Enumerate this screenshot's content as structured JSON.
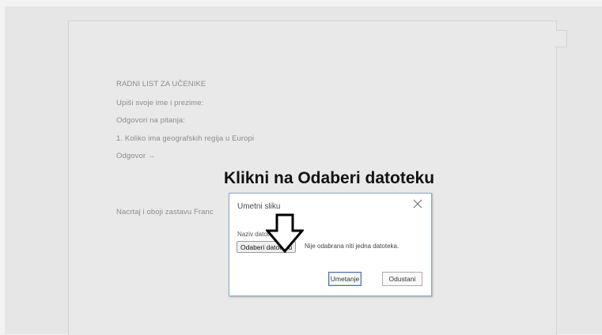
{
  "document": {
    "lines": [
      "RADNI LIST ZA UČENIKE",
      "Upiši svoje ime i prezime:",
      "Odgovori na pitanja:",
      "1. Koliko ima geografskih regija u Europi",
      "Odgovor →",
      "Nacrtaj i oboji zastavu Franc"
    ]
  },
  "overlay": {
    "instruction": "Klikni na Odaberi datoteku"
  },
  "dialog": {
    "title": "Umetni sliku",
    "field_label": "Naziv datoteke:",
    "choose_file_label": "Odaberi datoteku",
    "file_status": "Nije odabrana niti jedna datoteka.",
    "insert_label": "Umetanje",
    "cancel_label": "Odustani",
    "close_icon": "close-icon"
  },
  "colors": {
    "dialog_border": "#8aa6c8",
    "primary_button_border": "#4d6fa8"
  }
}
